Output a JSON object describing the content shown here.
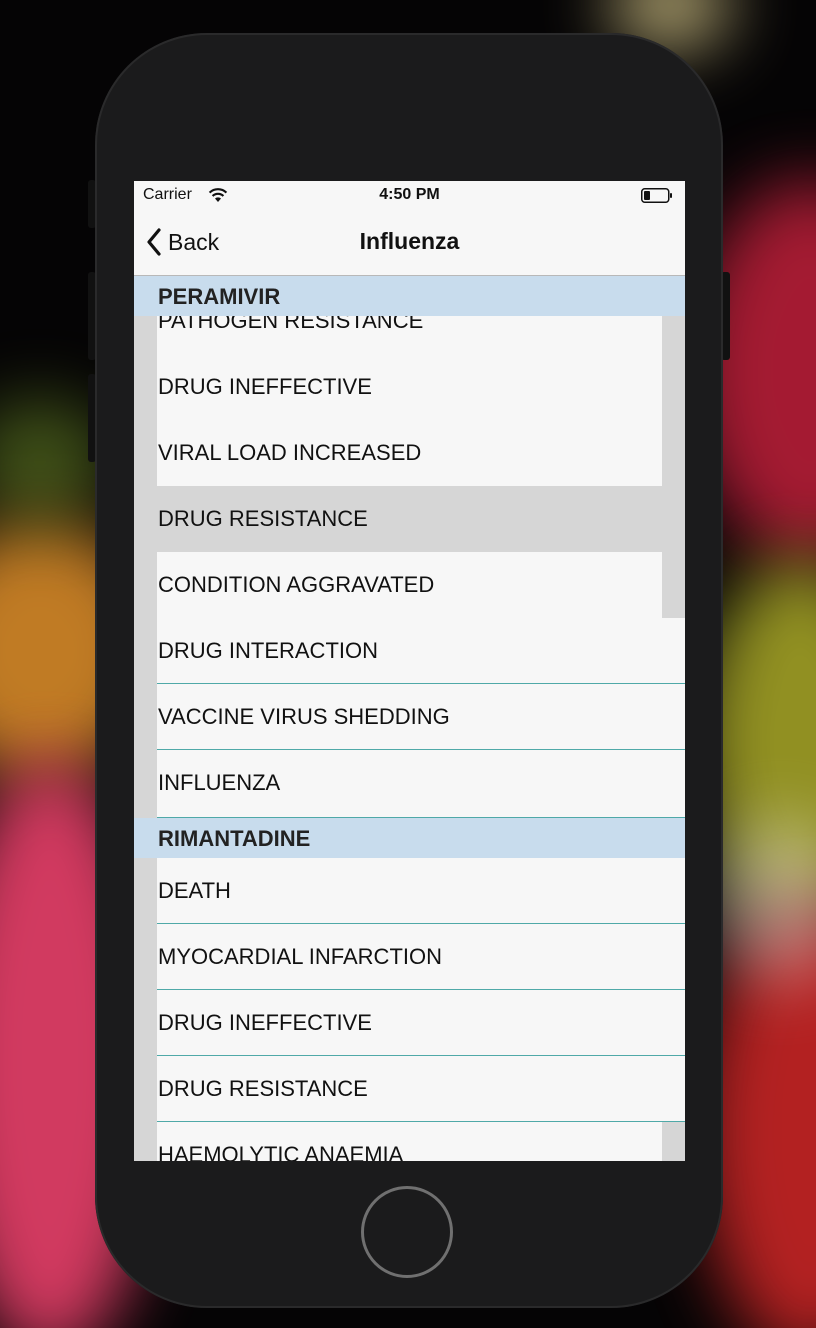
{
  "status": {
    "carrier": "Carrier",
    "time": "4:50 PM"
  },
  "nav": {
    "back_label": "Back",
    "title": "Influenza"
  },
  "sections": [
    {
      "header": "PERAMIVIR",
      "rows": [
        "PATHOGEN RESISTANCE",
        "DRUG INEFFECTIVE",
        "VIRAL LOAD INCREASED",
        "DRUG RESISTANCE",
        "CONDITION AGGRAVATED",
        "DRUG INTERACTION",
        "VACCINE VIRUS SHEDDING",
        "INFLUENZA"
      ]
    },
    {
      "header": "RIMANTADINE",
      "rows": [
        "DEATH",
        "MYOCARDIAL INFARCTION",
        "DRUG INEFFECTIVE",
        "DRUG RESISTANCE",
        "HAEMOLYTIC ANAEMIA"
      ]
    }
  ],
  "colors": {
    "section_header_bg": "#c8dced",
    "separator": "#4fa9a8",
    "selected_row": "#d6d6d6"
  }
}
